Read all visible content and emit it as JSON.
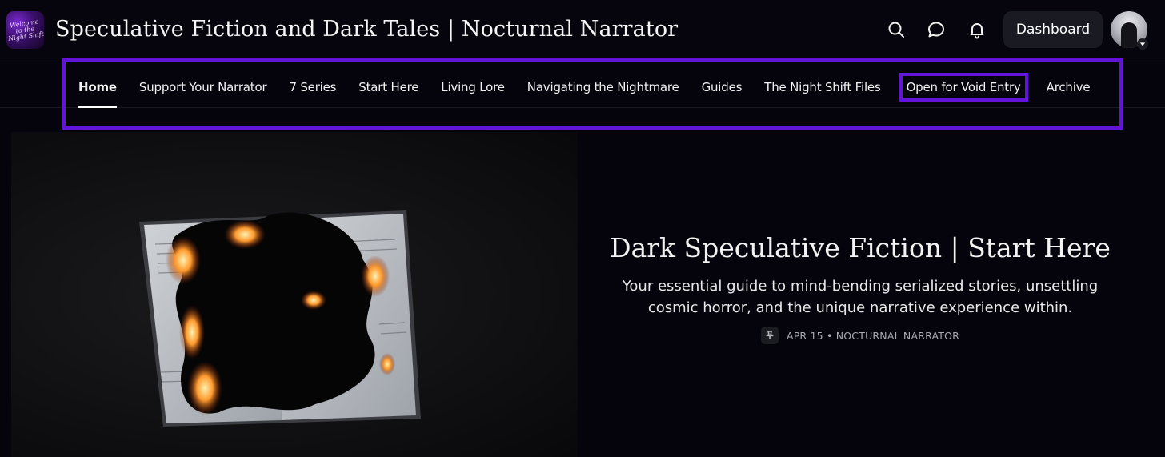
{
  "header": {
    "logo_text": "Welcome to the Night Shift",
    "site_title": "Speculative Fiction and Dark Tales | Nocturnal Narrator",
    "icons": [
      "search-icon",
      "chat-icon",
      "bell-icon"
    ],
    "dashboard_label": "Dashboard"
  },
  "nav": {
    "items": [
      {
        "label": "Home",
        "active": true
      },
      {
        "label": "Support Your Narrator"
      },
      {
        "label": "7 Series"
      },
      {
        "label": "Start Here"
      },
      {
        "label": "Living Lore"
      },
      {
        "label": "Navigating the Nightmare"
      },
      {
        "label": "Guides"
      },
      {
        "label": "The Night Shift Files"
      },
      {
        "label": "Open for Void Entry",
        "highlighted": true
      },
      {
        "label": "Archive"
      }
    ],
    "highlight_color": "#6214d9"
  },
  "hero": {
    "title": "Dark Speculative Fiction | Start Here",
    "subtitle": "Your essential guide to mind-bending serialized stories, unsettling cosmic horror, and the unique narrative experience within.",
    "meta": "APR 15 • NOCTURNAL NARRATOR",
    "meta_icon": "pin-icon",
    "image_subject": "burning-book-icon"
  }
}
